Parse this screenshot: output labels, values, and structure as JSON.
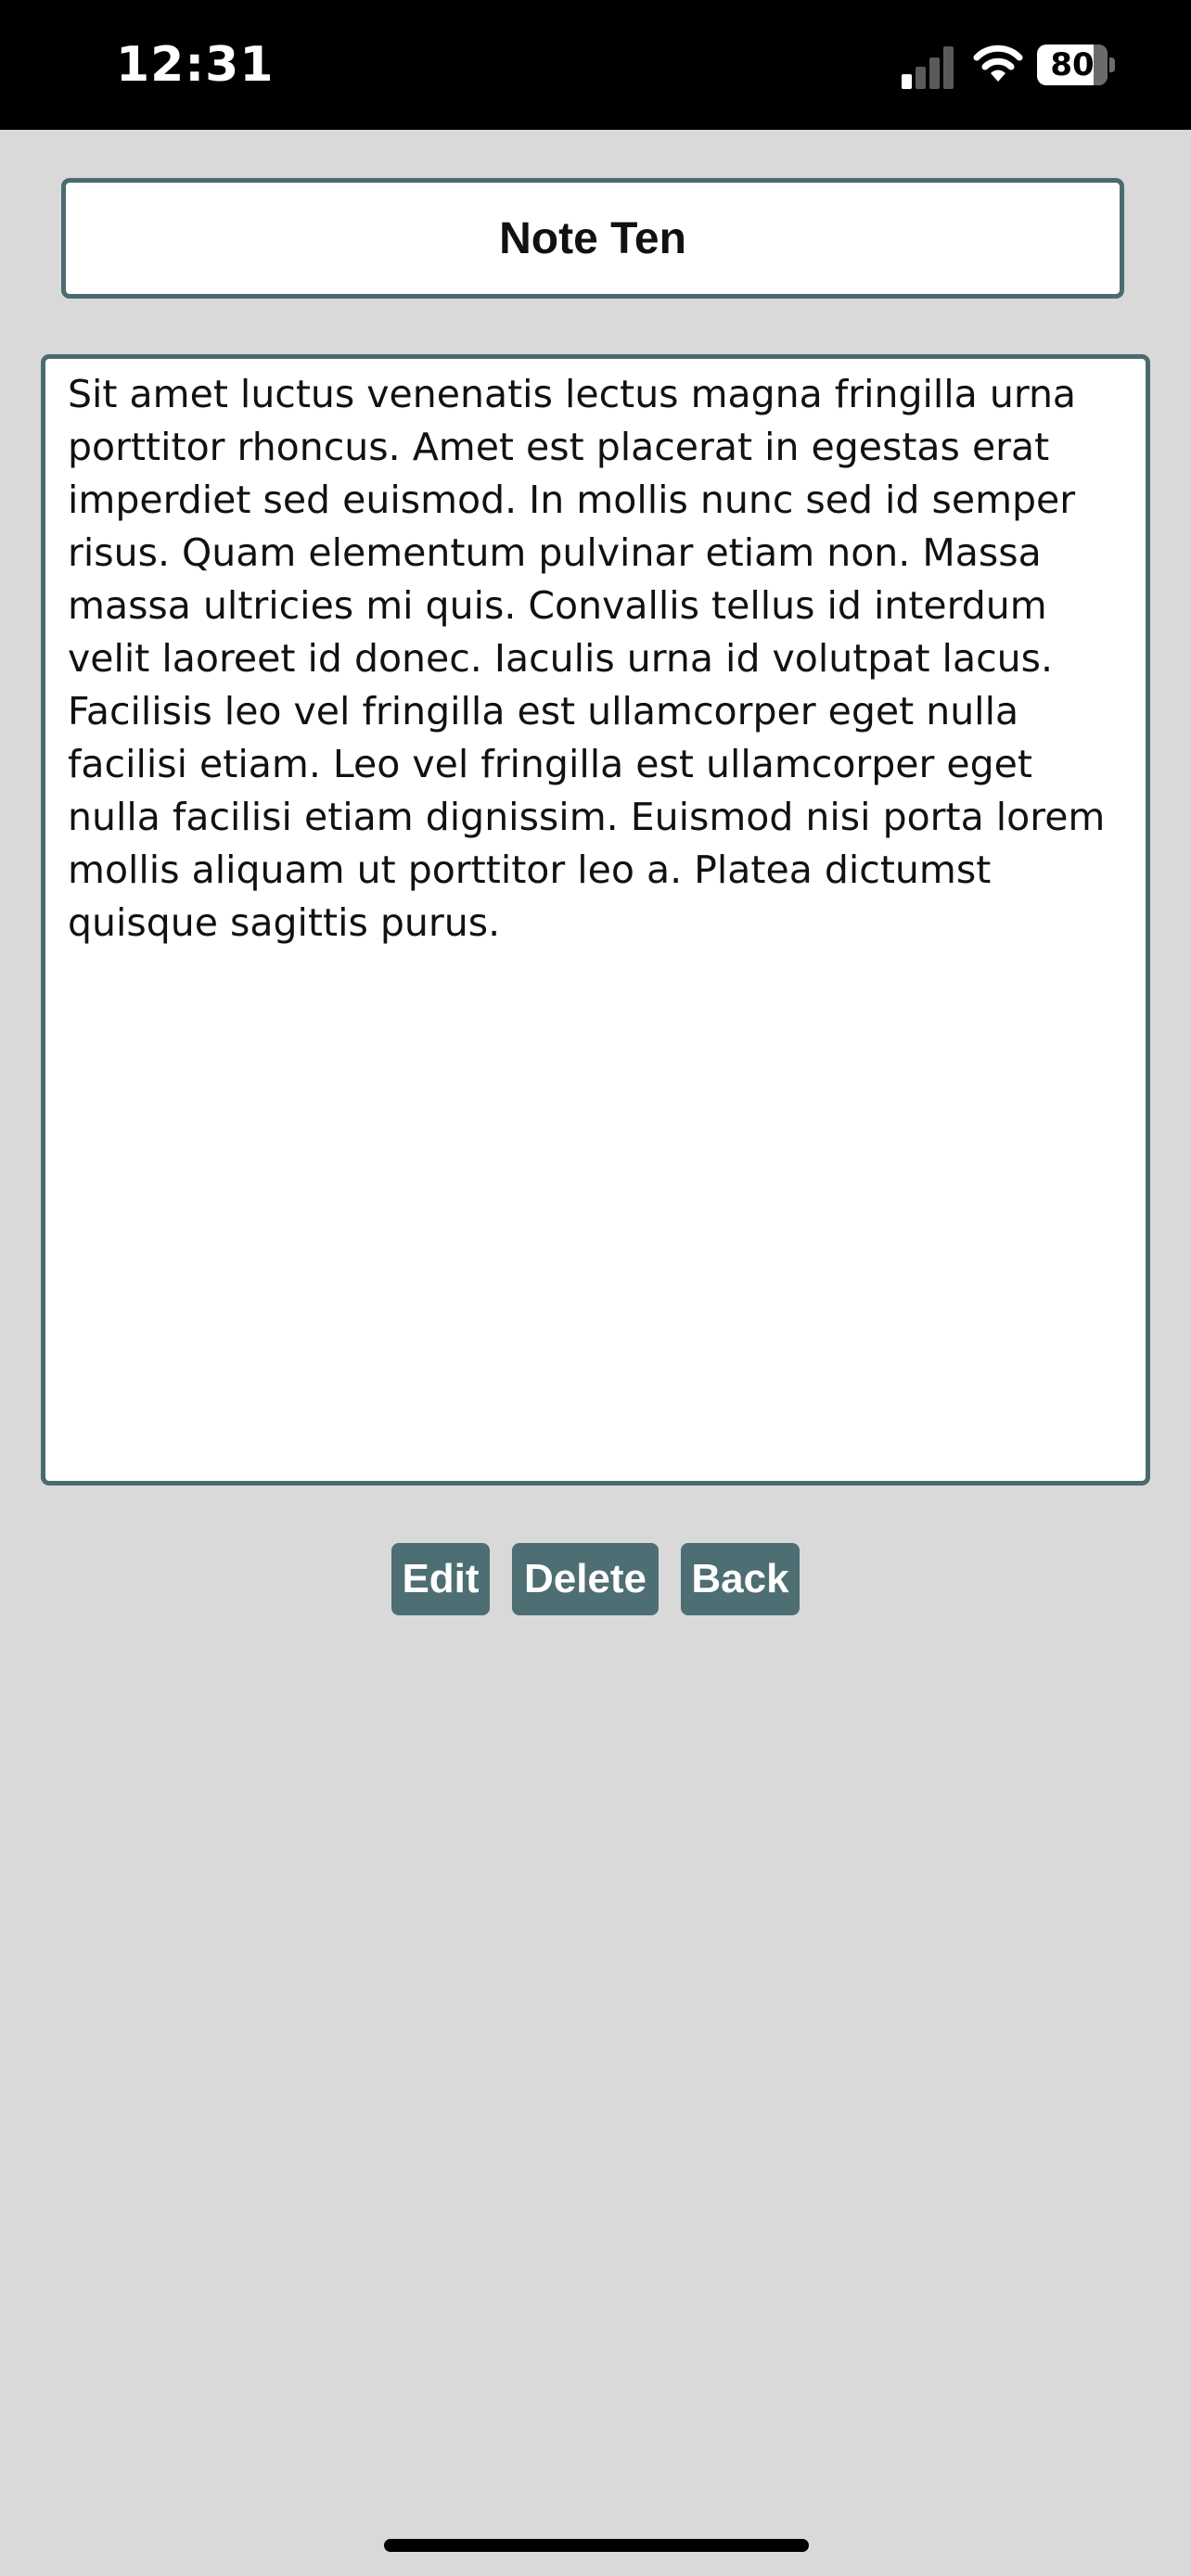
{
  "status_bar": {
    "time": "12:31",
    "battery_level": "80",
    "battery_fraction": 0.8,
    "signal_bars_active": 1,
    "signal_bars_total": 4,
    "icons": [
      "cellular-signal-icon",
      "wifi-icon",
      "battery-icon"
    ]
  },
  "note": {
    "title": "Note Ten",
    "body": "Sit amet luctus venenatis lectus magna fringilla urna porttitor rhoncus. Amet est placerat in egestas erat imperdiet sed euismod. In mollis nunc sed id semper risus. Quam elementum pulvinar etiam non. Massa massa ultricies mi quis. Convallis tellus id interdum velit laoreet id donec. Iaculis urna id volutpat lacus. Facilisis leo vel fringilla est ullamcorper eget nulla facilisi etiam. Leo vel fringilla est ullamcorper eget nulla facilisi etiam dignissim. Euismod nisi porta lorem mollis aliquam ut porttitor leo a. Platea dictumst quisque sagittis purus."
  },
  "actions": {
    "edit_label": "Edit",
    "delete_label": "Delete",
    "back_label": "Back"
  },
  "colors": {
    "background": "#d9d9d9",
    "accent": "#4d6e72",
    "border": "#4a6b70",
    "status_bar": "#000000"
  }
}
